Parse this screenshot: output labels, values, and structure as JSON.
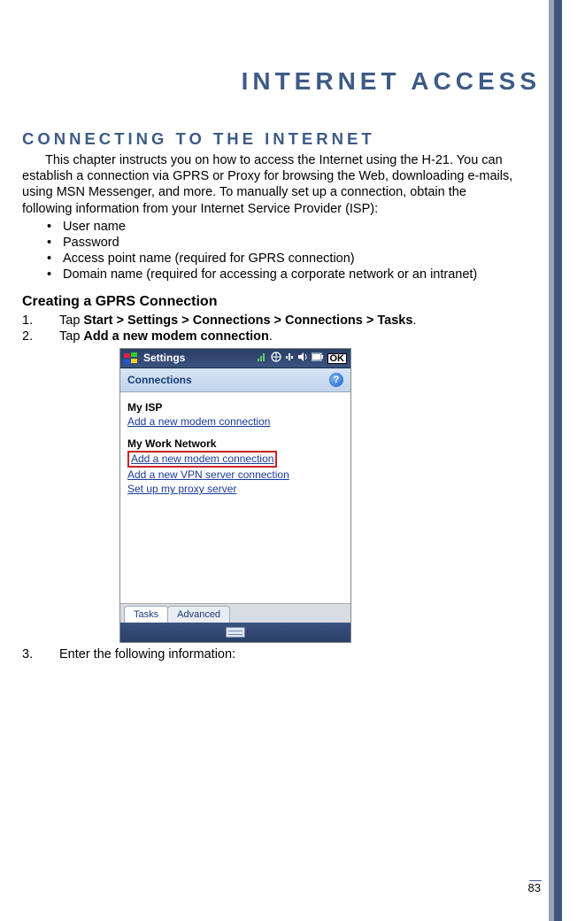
{
  "title": "Internet Access",
  "section_heading": "Connecting to the Internet",
  "intro": "This chapter instructs you on how to access the Internet using the H-21. You can establish a connection via GPRS or Proxy for browsing the Web, downloading e-mails, using MSN Messenger, and more. To manually set up a connection, obtain the following information from your Internet Service Provider (ISP):",
  "bullets": [
    "User name",
    "Password",
    "Access point name (required for GPRS connection)",
    "Domain name (required for accessing a corporate network or an intranet)"
  ],
  "sub_heading": "Creating a GPRS Connection",
  "steps": [
    {
      "num": "1.",
      "prefix": "Tap ",
      "bold": "Start > Settings > Connections > Connections > Tasks",
      "suffix": "."
    },
    {
      "num": "2.",
      "prefix": "Tap ",
      "bold": "Add a new modem connection",
      "suffix": "."
    },
    {
      "num": "3.",
      "prefix": "Enter the following information:",
      "bold": "",
      "suffix": ""
    }
  ],
  "screenshot": {
    "topbar_title": "Settings",
    "header_title": "Connections",
    "group1_title": "My ISP",
    "group1_link1": "Add a new modem connection",
    "group2_title": "My Work Network",
    "group2_link1": "Add a new modem connection",
    "group2_link2": "Add a new VPN server connection",
    "group2_link3": "Set up my proxy server",
    "tab1": "Tasks",
    "tab2": "Advanced",
    "ok": "OK",
    "help": "?"
  },
  "page_number": "83"
}
